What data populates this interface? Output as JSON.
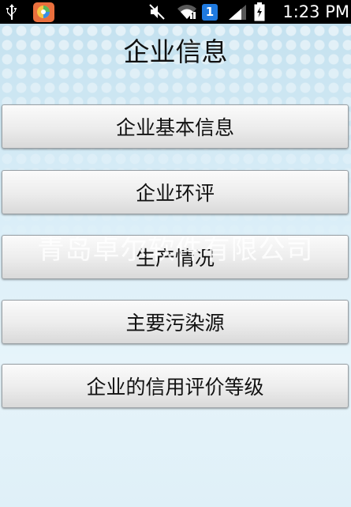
{
  "status_bar": {
    "time": "1:23 PM",
    "notification_count": "1",
    "icons": [
      "usb-icon",
      "app-icon",
      "mute-icon",
      "wifi-icon",
      "notification-badge",
      "signal-icon",
      "battery-charging-icon"
    ]
  },
  "page": {
    "title": "企业信息"
  },
  "menu": {
    "items": [
      {
        "label": "企业基本信息"
      },
      {
        "label": "企业环评"
      },
      {
        "label": "生产情况"
      },
      {
        "label": "主要污染源"
      },
      {
        "label": "企业的信用评价等级"
      }
    ]
  },
  "watermark": {
    "text": "青岛卓尔软件有限公司"
  },
  "colors": {
    "status_bar_bg": "#000000",
    "background": "#d6ecf6",
    "button_face": "#ececec",
    "notification_badge": "#1f7ae0"
  }
}
